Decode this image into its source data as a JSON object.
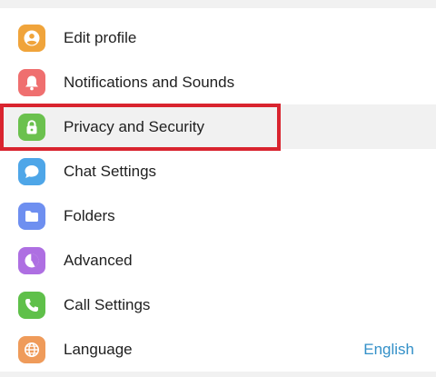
{
  "menu": {
    "items": [
      {
        "label": "Edit profile",
        "icon": "user-icon",
        "color": "#f0a43b"
      },
      {
        "label": "Notifications and Sounds",
        "icon": "bell-icon",
        "color": "#ef6f6f"
      },
      {
        "label": "Privacy and Security",
        "icon": "lock-icon",
        "color": "#6bc14e"
      },
      {
        "label": "Chat Settings",
        "icon": "chat-bubble-icon",
        "color": "#4ea6e8"
      },
      {
        "label": "Folders",
        "icon": "folder-icon",
        "color": "#6e8ff0"
      },
      {
        "label": "Advanced",
        "icon": "pie-chart-icon",
        "color": "#ae6fe2"
      },
      {
        "label": "Call Settings",
        "icon": "phone-icon",
        "color": "#5fc04a"
      },
      {
        "label": "Language",
        "icon": "globe-icon",
        "color": "#ef9b5a",
        "value": "English"
      }
    ],
    "active_index": 2
  },
  "highlight": {
    "color": "#d9242f"
  }
}
